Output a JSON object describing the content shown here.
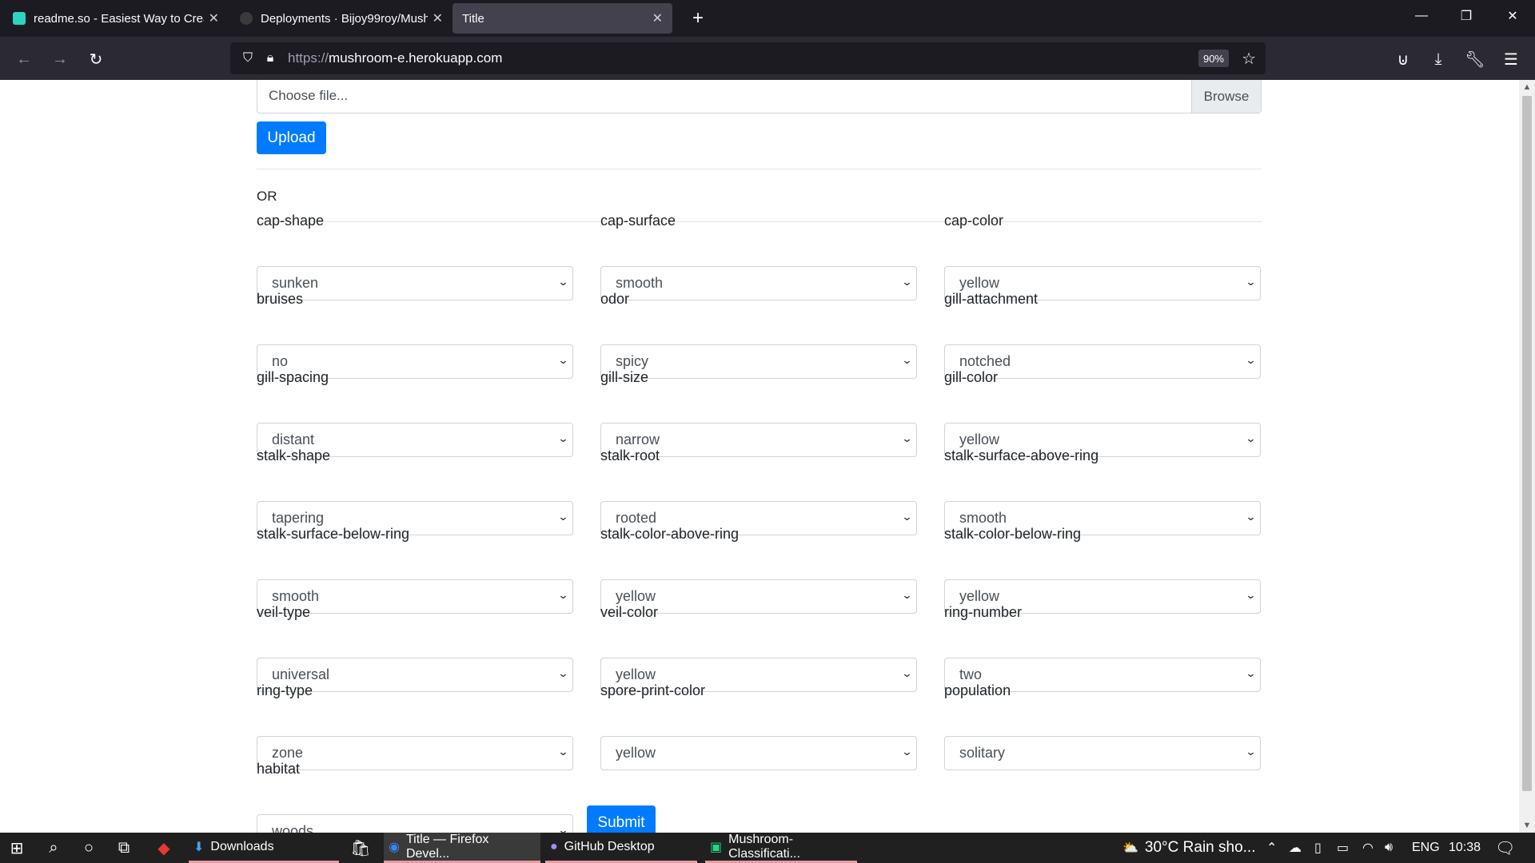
{
  "browser": {
    "tabs": [
      {
        "title": "readme.so - Easiest Way to Crea",
        "active": false,
        "favicon_color": "#2dd4bf"
      },
      {
        "title": "Deployments · Bijoy99roy/Mush",
        "active": false,
        "favicon_color": "#3a3a3a"
      },
      {
        "title": "Title",
        "active": true,
        "favicon_color": ""
      }
    ],
    "new_tab_icon": "plus-icon",
    "url_protocol": "https://",
    "url_host": "mushroom-e.herokuapp.com",
    "zoom": "90%"
  },
  "page": {
    "file_placeholder": "Choose file...",
    "browse_label": "Browse",
    "upload_label": "Upload",
    "or_label": "OR",
    "submit_label": "Submit",
    "fields": [
      {
        "label": "cap-shape",
        "value": "sunken"
      },
      {
        "label": "cap-surface",
        "value": "smooth"
      },
      {
        "label": "cap-color",
        "value": "yellow"
      },
      {
        "label": "bruises",
        "value": "no"
      },
      {
        "label": "odor",
        "value": "spicy"
      },
      {
        "label": "gill-attachment",
        "value": "notched"
      },
      {
        "label": "gill-spacing",
        "value": "distant"
      },
      {
        "label": "gill-size",
        "value": "narrow"
      },
      {
        "label": "gill-color",
        "value": "yellow"
      },
      {
        "label": "stalk-shape",
        "value": "tapering"
      },
      {
        "label": "stalk-root",
        "value": "rooted"
      },
      {
        "label": "stalk-surface-above-ring",
        "value": "smooth"
      },
      {
        "label": "stalk-surface-below-ring",
        "value": "smooth"
      },
      {
        "label": "stalk-color-above-ring",
        "value": "yellow"
      },
      {
        "label": "stalk-color-below-ring",
        "value": "yellow"
      },
      {
        "label": "veil-type",
        "value": "universal"
      },
      {
        "label": "veil-color",
        "value": "yellow"
      },
      {
        "label": "ring-number",
        "value": "two"
      },
      {
        "label": "ring-type",
        "value": "zone"
      },
      {
        "label": "spore-print-color",
        "value": "yellow"
      },
      {
        "label": "population",
        "value": "solitary"
      },
      {
        "label": "habitat",
        "value": "woods"
      }
    ]
  },
  "taskbar": {
    "apps": [
      {
        "label": "Downloads",
        "icon": "download-arrow-icon"
      },
      {
        "label": "Title — Firefox Devel...",
        "icon": "firefox-icon"
      },
      {
        "label": "GitHub Desktop",
        "icon": "github-icon"
      },
      {
        "label": "Mushroom-Classificati...",
        "icon": "pycharm-icon"
      }
    ],
    "weather": "30°C  Rain sho...",
    "language": "ENG",
    "time": "10:38"
  },
  "colors": {
    "primary_button": "#007bff",
    "tab_bar": "#1c1b22",
    "nav_bar": "#2b2a33",
    "taskbar": "#202020"
  }
}
